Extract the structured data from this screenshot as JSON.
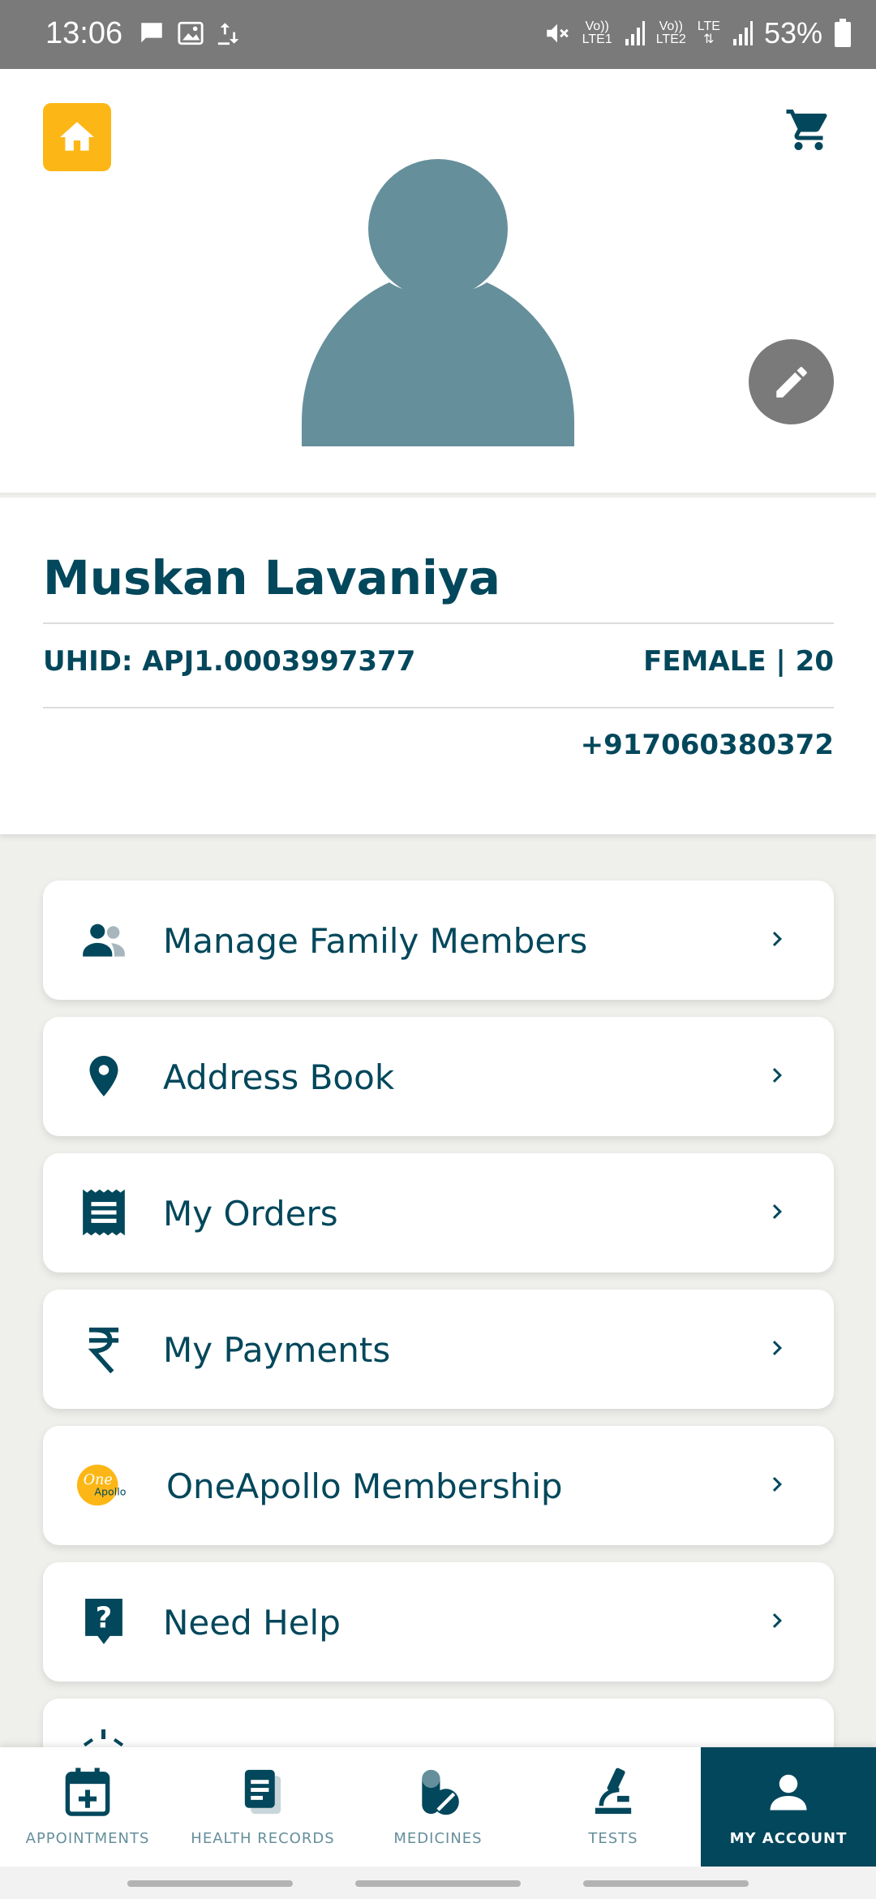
{
  "status_bar": {
    "time": "13:06",
    "lte1": "LTE1",
    "lte2": "LTE2",
    "vo": "Vo))",
    "lte": "LTE",
    "battery_pct": "53%"
  },
  "header": {
    "home_icon": "home-icon",
    "cart_icon": "cart-icon",
    "avatar_icon": "person-avatar",
    "edit_icon": "pencil-icon"
  },
  "profile": {
    "name": "Muskan Lavaniya",
    "uhid": "UHID: APJ1.0003997377",
    "gender_age": "FEMALE | 20",
    "phone": "+917060380372"
  },
  "menu": {
    "items": [
      {
        "label": "Manage Family Members",
        "icon": "family-icon"
      },
      {
        "label": "Address Book",
        "icon": "location-pin-icon"
      },
      {
        "label": "My Orders",
        "icon": "receipt-icon"
      },
      {
        "label": "My Payments",
        "icon": "rupee-icon"
      },
      {
        "label": "OneApollo Membership",
        "icon": "oneapollo-logo"
      },
      {
        "label": "Need Help",
        "icon": "help-icon"
      }
    ],
    "oneapollo_logo_text": "One Apollo"
  },
  "bottom_nav": {
    "tabs": [
      {
        "label": "APPOINTMENTS",
        "icon": "calendar-plus-icon"
      },
      {
        "label": "HEALTH RECORDS",
        "icon": "records-icon"
      },
      {
        "label": "MEDICINES",
        "icon": "medicine-icon"
      },
      {
        "label": "TESTS",
        "icon": "microscope-icon"
      },
      {
        "label": "MY ACCOUNT",
        "icon": "account-icon"
      }
    ],
    "active_index": 4
  },
  "colors": {
    "primary": "#02475b",
    "accent_yellow": "#fcb716",
    "avatar": "#658f9b",
    "status_bar": "#7a7a7a"
  }
}
